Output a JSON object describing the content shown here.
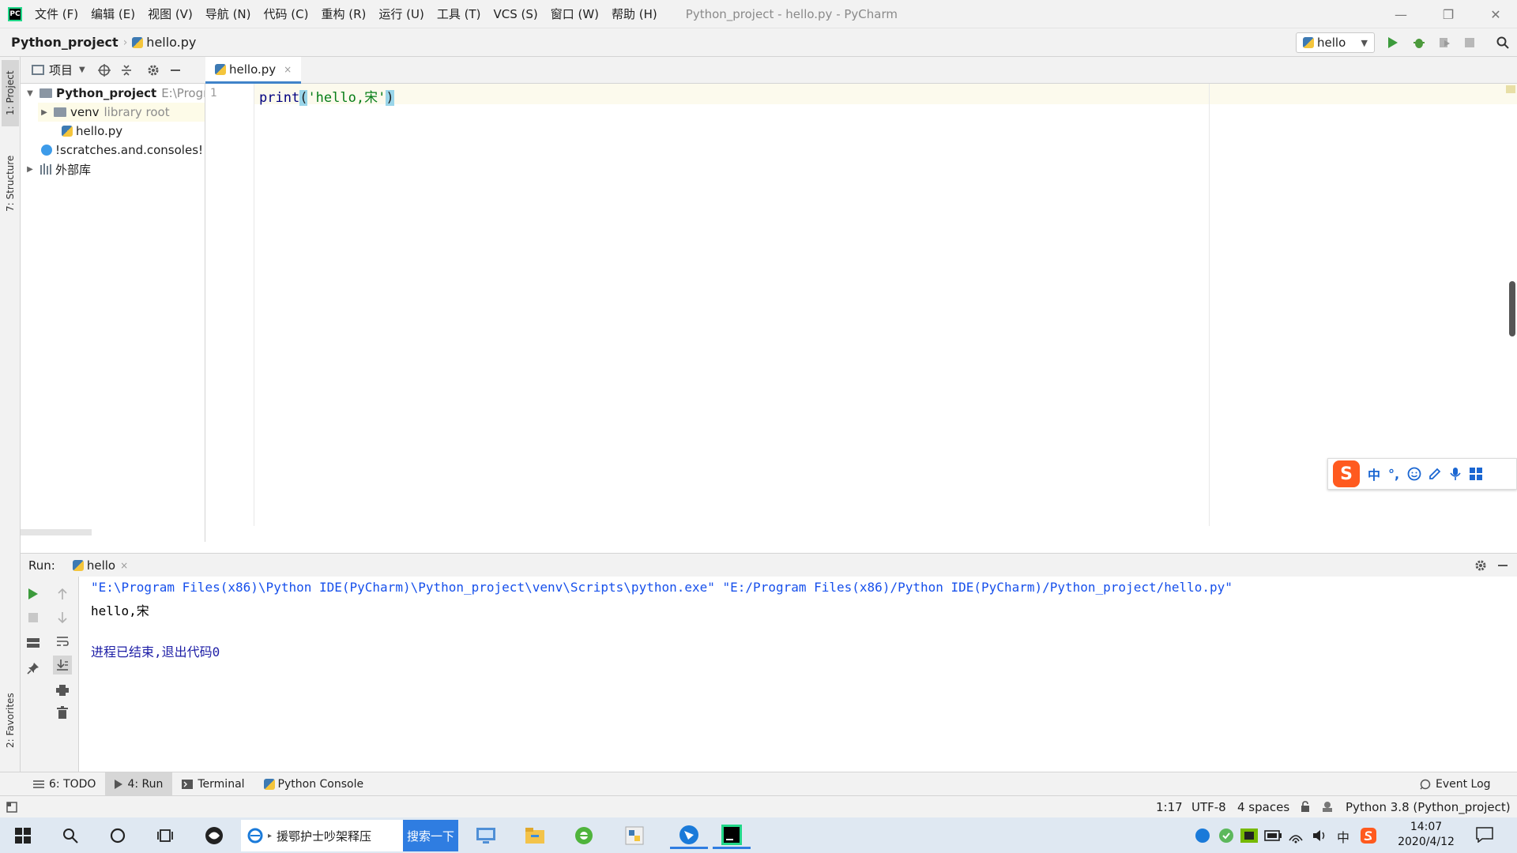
{
  "menubar": {
    "logo": "PC",
    "items": [
      "文件 (F)",
      "编辑 (E)",
      "视图 (V)",
      "导航 (N)",
      "代码 (C)",
      "重构 (R)",
      "运行 (U)",
      "工具 (T)",
      "VCS (S)",
      "窗口 (W)",
      "帮助 (H)"
    ],
    "window_title": "Python_project - hello.py - PyCharm",
    "minimize": "—",
    "restore": "❐",
    "close": "✕"
  },
  "navbar": {
    "project": "Python_project",
    "sep": "›",
    "file": "hello.py",
    "run_config": "hello",
    "run_config_arrow": "▼"
  },
  "icons": {
    "run": "run-icon",
    "debug": "debug-icon",
    "coverage": "coverage-icon",
    "stop": "stop-icon",
    "search": "search-icon"
  },
  "left_stripe": {
    "project_tab": "1: Project",
    "structure_tab": "7: Structure",
    "favorites_tab": "2: Favorites"
  },
  "project_panel": {
    "title": "项目",
    "tree": [
      {
        "arrow": "▼",
        "name": "Python_project",
        "hint": "E:\\Progr"
      },
      {
        "arrow": "▶",
        "name": "venv",
        "hint": "library root"
      },
      {
        "arrow": "",
        "name": "hello.py",
        "hint": ""
      },
      {
        "arrow": "",
        "name": "!scratches.and.consoles!",
        "hint": ""
      },
      {
        "arrow": "▶",
        "name": "外部库",
        "hint": ""
      }
    ]
  },
  "editor": {
    "tab": "hello.py",
    "tab_close": "×",
    "line_number": "1",
    "code": {
      "fn": "print",
      "open": "(",
      "string": "'hello,宋'",
      "close": ")"
    }
  },
  "ime": {
    "logo": "S",
    "lang": "中",
    "punct": "°,"
  },
  "run_panel": {
    "label": "Run:",
    "tab": "hello",
    "tab_close": "×",
    "lines": [
      "\"E:\\Program Files(x86)\\Python IDE(PyCharm)\\Python_project\\venv\\Scripts\\python.exe\" \"E:/Program Files(x86)/Python IDE(PyCharm)/Python_project/hello.py\"",
      "hello,宋",
      "",
      "进程已结束,退出代码0"
    ],
    "colors": {
      "command": "#1750eb",
      "output": "#000000",
      "exit": "#1d1ea6"
    }
  },
  "bottom_tools": {
    "todo": "6: TODO",
    "run": "4: Run",
    "terminal": "Terminal",
    "python_console": "Python Console",
    "event_log": "Event Log"
  },
  "statusbar": {
    "position": "1:17",
    "encoding": "UTF-8",
    "indent": "4 spaces",
    "interpreter": "Python 3.8 (Python_project)"
  },
  "taskbar": {
    "search_text": "援鄂护士吵架释压",
    "search_button": "搜索一下",
    "time": "14:07",
    "date": "2020/4/12",
    "tray_lang": "中"
  }
}
